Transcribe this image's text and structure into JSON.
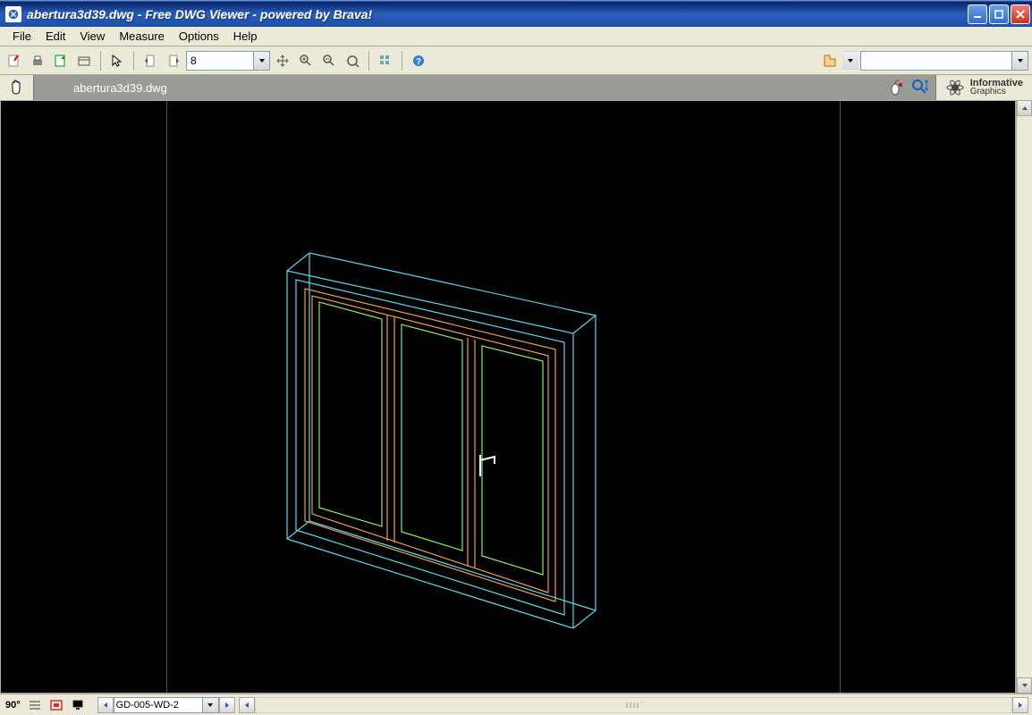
{
  "title": "abertura3d39.dwg - Free DWG Viewer - powered by Brava!",
  "menu": {
    "file": "File",
    "edit": "Edit",
    "view": "View",
    "measure": "Measure",
    "options": "Options",
    "help": "Help"
  },
  "toolbar": {
    "page_value": "8"
  },
  "tabbar": {
    "document_name": "abertura3d39.dwg",
    "brand_top": "Informative",
    "brand_bot": "Graphics"
  },
  "statusbar": {
    "rotate_label": "90°",
    "sheet_value": "GD-005-WD-2"
  }
}
